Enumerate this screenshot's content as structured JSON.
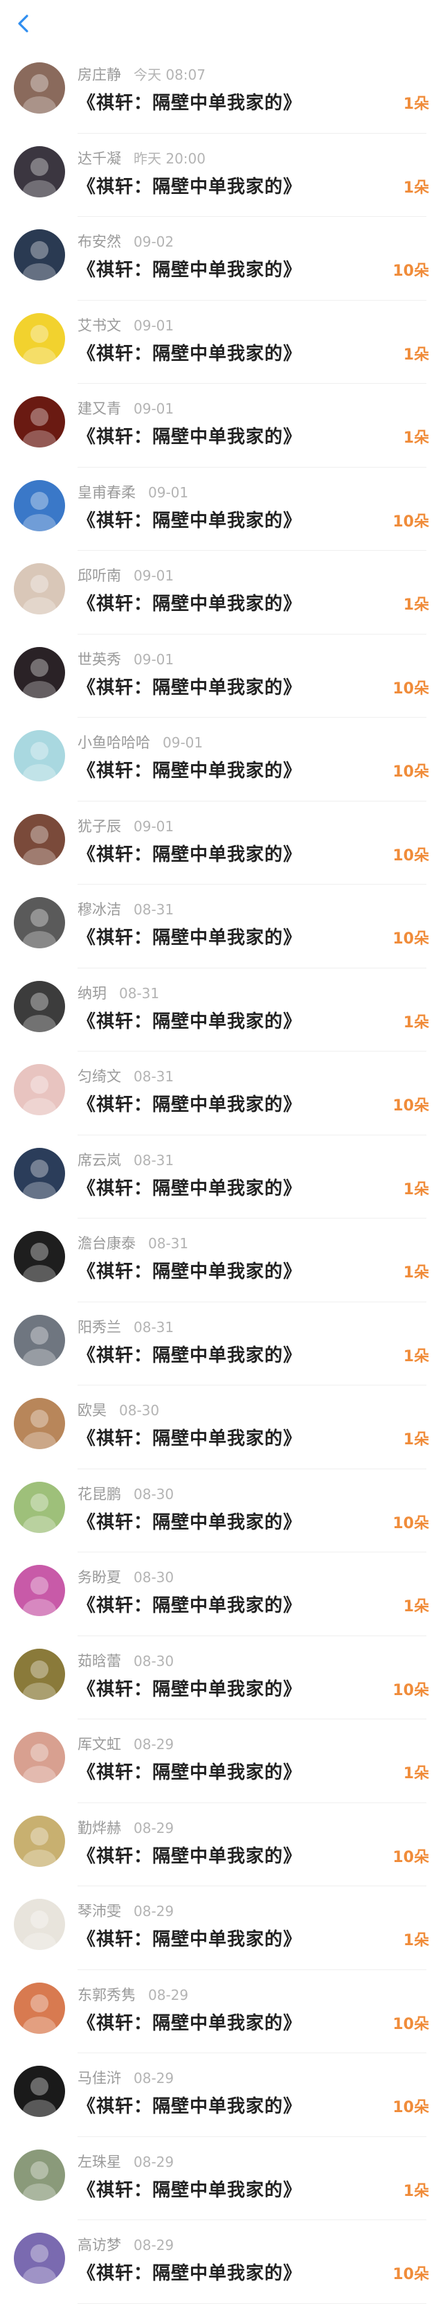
{
  "header": {
    "back_icon": "chevron-left-icon",
    "accent_color": "#2f8ef0"
  },
  "colors": {
    "count": "#f08c3a",
    "name": "#9a9a9a",
    "title": "#222222"
  },
  "records": [
    {
      "name": "房庄静",
      "time": "今天 08:07",
      "title": "《祺轩：隔壁中单我家的》",
      "count": "1朵",
      "avatar": "#8a6a5c"
    },
    {
      "name": "达千凝",
      "time": "昨天 20:00",
      "title": "《祺轩：隔壁中单我家的》",
      "count": "1朵",
      "avatar": "#3b3640"
    },
    {
      "name": "布安然",
      "time": "09-02",
      "title": "《祺轩：隔壁中单我家的》",
      "count": "10朵",
      "avatar": "#2a3a52"
    },
    {
      "name": "艾书文",
      "time": "09-01",
      "title": "《祺轩：隔壁中单我家的》",
      "count": "1朵",
      "avatar": "#f2d22e"
    },
    {
      "name": "建又青",
      "time": "09-01",
      "title": "《祺轩：隔壁中单我家的》",
      "count": "1朵",
      "avatar": "#6a1a12"
    },
    {
      "name": "皇甫春柔",
      "time": "09-01",
      "title": "《祺轩：隔壁中单我家的》",
      "count": "10朵",
      "avatar": "#3a78c8"
    },
    {
      "name": "邱听南",
      "time": "09-01",
      "title": "《祺轩：隔壁中单我家的》",
      "count": "1朵",
      "avatar": "#d9c7b8"
    },
    {
      "name": "世英秀",
      "time": "09-01",
      "title": "《祺轩：隔壁中单我家的》",
      "count": "10朵",
      "avatar": "#2a2226"
    },
    {
      "name": "小鱼哈哈哈",
      "time": "09-01",
      "title": "《祺轩：隔壁中单我家的》",
      "count": "10朵",
      "avatar": "#a9d8e0"
    },
    {
      "name": "犹子辰",
      "time": "09-01",
      "title": "《祺轩：隔壁中单我家的》",
      "count": "10朵",
      "avatar": "#7a4a3a"
    },
    {
      "name": "穆冰洁",
      "time": "08-31",
      "title": "《祺轩：隔壁中单我家的》",
      "count": "10朵",
      "avatar": "#5a5a5a"
    },
    {
      "name": "纳玥",
      "time": "08-31",
      "title": "《祺轩：隔壁中单我家的》",
      "count": "1朵",
      "avatar": "#3c3c3c"
    },
    {
      "name": "匀绮文",
      "time": "08-31",
      "title": "《祺轩：隔壁中单我家的》",
      "count": "10朵",
      "avatar": "#e8c4c0"
    },
    {
      "name": "席云岚",
      "time": "08-31",
      "title": "《祺轩：隔壁中单我家的》",
      "count": "1朵",
      "avatar": "#2b3d5a"
    },
    {
      "name": "澹台康泰",
      "time": "08-31",
      "title": "《祺轩：隔壁中单我家的》",
      "count": "1朵",
      "avatar": "#1e1e1e"
    },
    {
      "name": "阳秀兰",
      "time": "08-31",
      "title": "《祺轩：隔壁中单我家的》",
      "count": "1朵",
      "avatar": "#6f7680"
    },
    {
      "name": "欧昊",
      "time": "08-30",
      "title": "《祺轩：隔壁中单我家的》",
      "count": "1朵",
      "avatar": "#b8865a"
    },
    {
      "name": "花昆鹏",
      "time": "08-30",
      "title": "《祺轩：隔壁中单我家的》",
      "count": "10朵",
      "avatar": "#9ec07a"
    },
    {
      "name": "务盼夏",
      "time": "08-30",
      "title": "《祺轩：隔壁中单我家的》",
      "count": "1朵",
      "avatar": "#c85aa8"
    },
    {
      "name": "茹晗蕾",
      "time": "08-30",
      "title": "《祺轩：隔壁中单我家的》",
      "count": "10朵",
      "avatar": "#8a7a3a"
    },
    {
      "name": "厍文虹",
      "time": "08-29",
      "title": "《祺轩：隔壁中单我家的》",
      "count": "1朵",
      "avatar": "#d8a090"
    },
    {
      "name": "勤烨赫",
      "time": "08-29",
      "title": "《祺轩：隔壁中单我家的》",
      "count": "10朵",
      "avatar": "#c8b070"
    },
    {
      "name": "琴沛雯",
      "time": "08-29",
      "title": "《祺轩：隔壁中单我家的》",
      "count": "1朵",
      "avatar": "#e8e4dc"
    },
    {
      "name": "东郭秀隽",
      "time": "08-29",
      "title": "《祺轩：隔壁中单我家的》",
      "count": "10朵",
      "avatar": "#d87a50"
    },
    {
      "name": "马佳浒",
      "time": "08-29",
      "title": "《祺轩：隔壁中单我家的》",
      "count": "10朵",
      "avatar": "#1a1a1a"
    },
    {
      "name": "左珠星",
      "time": "08-29",
      "title": "《祺轩：隔壁中单我家的》",
      "count": "1朵",
      "avatar": "#8a9a7a"
    },
    {
      "name": "高访梦",
      "time": "08-29",
      "title": "《祺轩：隔壁中单我家的》",
      "count": "10朵",
      "avatar": "#7a6ab0"
    }
  ]
}
